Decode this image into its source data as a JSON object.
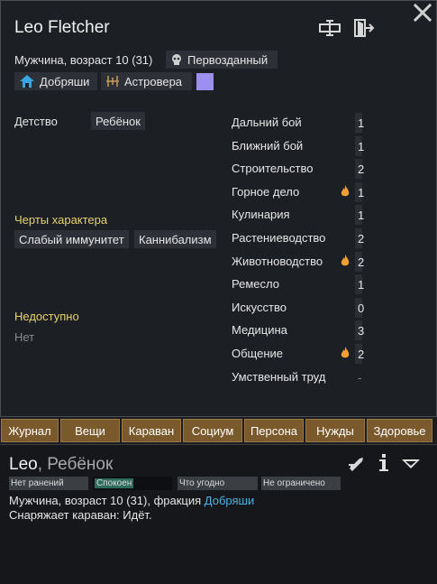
{
  "pawn": {
    "name": "Leo Fletcher",
    "subline": "Мужчина, возраст 10 (31)",
    "story_tag": "Первозданный",
    "faction_tag": "Добряши",
    "ideo_tag": "Астровера",
    "swatch_color": "#9d8ef2"
  },
  "backstory": {
    "childhood_label": "Детство",
    "childhood_value": "Ребёнок"
  },
  "traits": {
    "title": "Черты характера",
    "items": [
      "Слабый иммунитет",
      "Каннибализм"
    ]
  },
  "incapable": {
    "title": "Недоступно",
    "value": "Нет"
  },
  "skills": [
    {
      "name": "Дальний бой",
      "value": "1",
      "passion": false
    },
    {
      "name": "Ближний бой",
      "value": "1",
      "passion": false
    },
    {
      "name": "Строительство",
      "value": "2",
      "passion": false
    },
    {
      "name": "Горное дело",
      "value": "1",
      "passion": true
    },
    {
      "name": "Кулинария",
      "value": "1",
      "passion": false
    },
    {
      "name": "Растениеводство",
      "value": "2",
      "passion": false
    },
    {
      "name": "Животноводство",
      "value": "2",
      "passion": true
    },
    {
      "name": "Ремесло",
      "value": "1",
      "passion": false
    },
    {
      "name": "Искусство",
      "value": "0",
      "passion": false
    },
    {
      "name": "Медицина",
      "value": "3",
      "passion": false
    },
    {
      "name": "Общение",
      "value": "2",
      "passion": true
    },
    {
      "name": "Умственный труд",
      "value": "-",
      "passion": false
    }
  ],
  "tabs": [
    "Журнал",
    "Вещи",
    "Караван",
    "Социум",
    "Персона",
    "Нужды",
    "Здоровье"
  ],
  "inspector": {
    "short_name": "Leo",
    "comma": ", ",
    "title": "Ребёнок",
    "status": [
      "Нет ранений",
      "Спокоен",
      "Что угодно",
      "Не ограничено"
    ],
    "line1_prefix": "Мужчина, возраст 10 (31), фракция ",
    "line1_link": "Добряши",
    "line2": "Снаряжает караван: Идёт."
  },
  "colors": {
    "accent_link": "#4fb3e8",
    "section_title": "#e6d36e",
    "tab_bg": "#7a5a2c",
    "passion": "#f0a030"
  }
}
